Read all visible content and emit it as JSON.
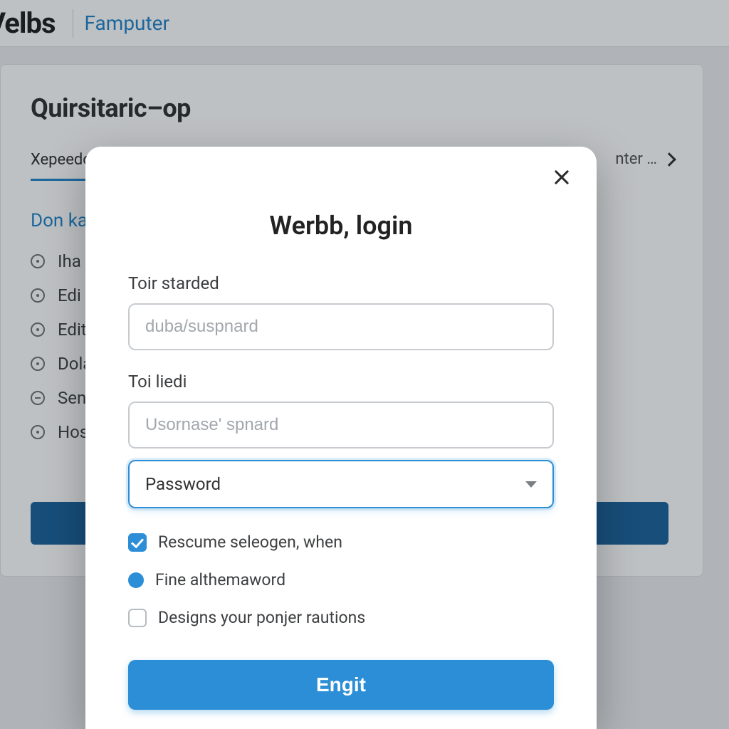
{
  "topbar": {
    "brand": "Velbs",
    "sublink": "Famputer"
  },
  "card": {
    "title": "Quirsitaric–op",
    "tab_active": "Xepeedo",
    "tab_right": "nter …",
    "section_link": "Don ka",
    "items": [
      "Iha",
      "Edi",
      "Edit",
      "Dola",
      "Sen",
      "Hos"
    ]
  },
  "modal": {
    "title": "Werbb, login",
    "field1": {
      "label": "Toir starded",
      "placeholder": "duba/suspnard"
    },
    "field2": {
      "label": "Toi liedi",
      "placeholder": "Usornase' spnard"
    },
    "select_value": "Password",
    "check1": "Rescume seleogen, when",
    "radio1": "Fine althemaword",
    "check2": "Designs your ponjer rautions",
    "submit": "Engit"
  }
}
